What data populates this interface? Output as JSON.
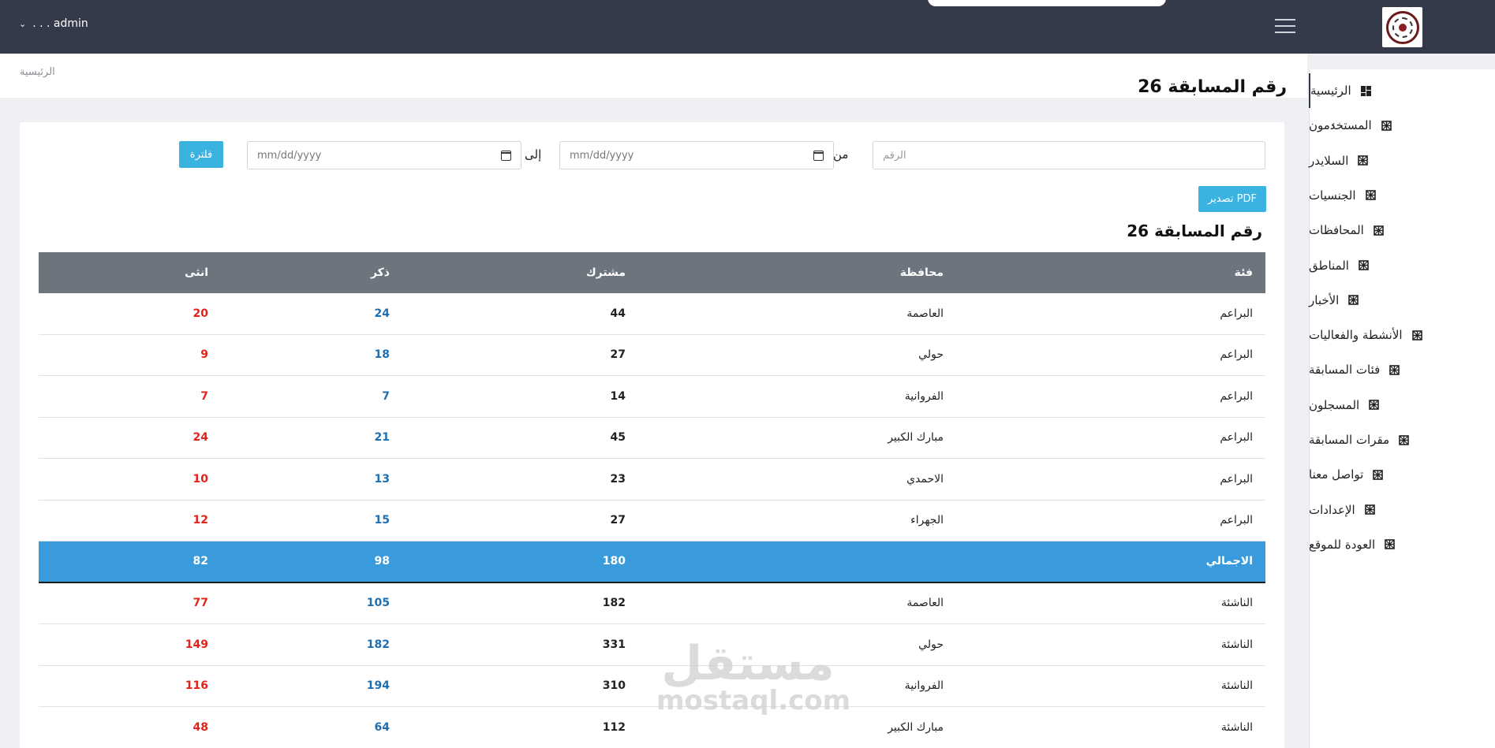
{
  "topbar": {
    "user_label": ". . . admin",
    "user_chevron": "⌄"
  },
  "header": {
    "breadcrumb": "الرئيسية",
    "page_title": "رقم المسابقة 26"
  },
  "sidebar": {
    "collapse_arrow": "›",
    "items": [
      {
        "label": "الرئيسية",
        "icon": "dashboard-icon",
        "active": true
      },
      {
        "label": "المستخدمون",
        "icon": "grid-icon",
        "has_submenu": true
      },
      {
        "label": "السلايدر",
        "icon": "grid-icon"
      },
      {
        "label": "الجنسيات",
        "icon": "grid-icon"
      },
      {
        "label": "المحافظات",
        "icon": "grid-icon"
      },
      {
        "label": "المناطق",
        "icon": "grid-icon"
      },
      {
        "label": "الأخبار",
        "icon": "grid-icon"
      },
      {
        "label": "الأنشطة والفعاليات",
        "icon": "grid-icon"
      },
      {
        "label": "فئات المسابقة",
        "icon": "grid-icon"
      },
      {
        "label": "المسجلون",
        "icon": "grid-icon"
      },
      {
        "label": "مقرات المسابقة",
        "icon": "grid-icon"
      },
      {
        "label": "تواصل معنا",
        "icon": "grid-icon"
      },
      {
        "label": "الإعدادات",
        "icon": "grid-icon"
      },
      {
        "label": "العودة للموقع",
        "icon": "grid-icon"
      }
    ]
  },
  "filters": {
    "number_placeholder": "الرقم",
    "from_label": "من",
    "to_label": "إلى",
    "date_from_placeholder": "mm/dd/yyyy",
    "date_to_placeholder": "mm/dd/yyyy",
    "filter_button": "فلترة",
    "pdf_button": "تصدير PDF"
  },
  "table": {
    "title": "رقم المسابقة 26",
    "headers": {
      "category": "فئة",
      "governorate": "محافظة",
      "participants": "مشترك",
      "male": "ذكر",
      "female": "انثى"
    },
    "rows": [
      {
        "category": "البراعم",
        "governorate": "العاصمة",
        "participants": "44",
        "male": "24",
        "female": "20"
      },
      {
        "category": "البراعم",
        "governorate": "حولي",
        "participants": "27",
        "male": "18",
        "female": "9"
      },
      {
        "category": "البراعم",
        "governorate": "الفروانية",
        "participants": "14",
        "male": "7",
        "female": "7"
      },
      {
        "category": "البراعم",
        "governorate": "مبارك الكبير",
        "participants": "45",
        "male": "21",
        "female": "24"
      },
      {
        "category": "البراعم",
        "governorate": "الاحمدي",
        "participants": "23",
        "male": "13",
        "female": "10"
      },
      {
        "category": "البراعم",
        "governorate": "الجهراء",
        "participants": "27",
        "male": "15",
        "female": "12"
      },
      {
        "category": "الاجمالي",
        "governorate": "",
        "participants": "180",
        "male": "98",
        "female": "82",
        "total": true
      },
      {
        "category": "الناشئة",
        "governorate": "العاصمة",
        "participants": "182",
        "male": "105",
        "female": "77"
      },
      {
        "category": "الناشئة",
        "governorate": "حولي",
        "participants": "331",
        "male": "182",
        "female": "149"
      },
      {
        "category": "الناشئة",
        "governorate": "الفروانية",
        "participants": "310",
        "male": "194",
        "female": "116"
      },
      {
        "category": "الناشئة",
        "governorate": "مبارك الكبير",
        "participants": "112",
        "male": "64",
        "female": "48"
      }
    ]
  },
  "watermark": {
    "arabic": "مستقل",
    "latin": "mostaql.com"
  },
  "colors": {
    "topbar": "#343a4a",
    "table_header": "#6c757d",
    "total_row": "#3a9bdc",
    "button": "#3bb3e0",
    "male": "#1f6fb0",
    "female": "#e0241b"
  }
}
